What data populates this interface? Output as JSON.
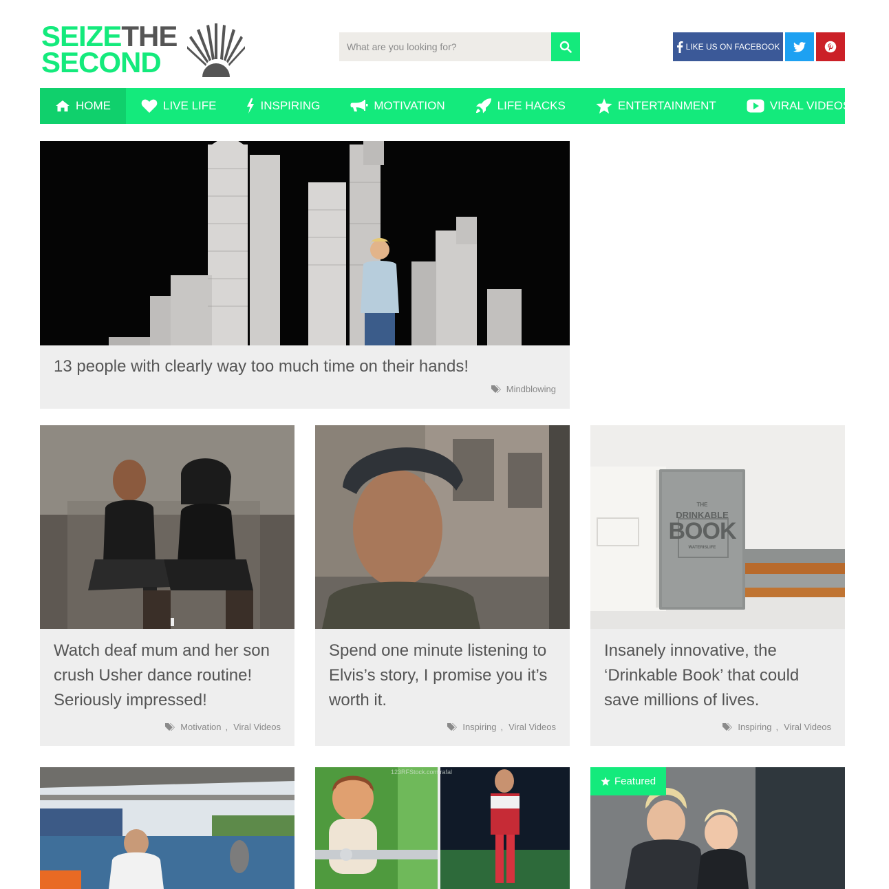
{
  "header": {
    "logo": {
      "line1_green": "SEIZE",
      "line1_dark": "THE",
      "line2_green": "SECOND"
    },
    "search": {
      "placeholder": "What are you looking for?"
    },
    "social": {
      "facebook_label": "LIKE US ON FACEBOOK"
    }
  },
  "nav": {
    "items": [
      {
        "label": "HOME",
        "icon": "home-icon"
      },
      {
        "label": "LIVE LIFE",
        "icon": "heart-icon"
      },
      {
        "label": "INSPIRING",
        "icon": "bolt-icon"
      },
      {
        "label": "MOTIVATION",
        "icon": "megaphone-icon"
      },
      {
        "label": "LIFE HACKS",
        "icon": "rocket-icon"
      },
      {
        "label": "ENTERTAINMENT",
        "icon": "star-icon"
      },
      {
        "label": "VIRAL VIDEOS",
        "icon": "play-icon"
      }
    ]
  },
  "featured": {
    "title": "13 people with clearly way too much time on their hands!",
    "tags": "Mindblowing"
  },
  "posts": [
    {
      "title": "Watch deaf mum and her son crush Usher dance routine! Seriously impressed!",
      "tag1": "Motivation",
      "tag2": "Viral Videos"
    },
    {
      "title": "Spend one minute listening to Elvis’s story, I promise you it’s worth it.",
      "tag1": "Inspiring",
      "tag2": "Viral Videos"
    },
    {
      "title": "Insanely innovative, the ‘Drinkable Book’ that could save millions of lives.",
      "tag1": "Inspiring",
      "tag2": "Viral Videos"
    }
  ],
  "bottom_cards": {
    "featured_badge": "Featured"
  },
  "image_text": {
    "book_top": "THE",
    "book_main_1": "DRINKABLE",
    "book_main_2": "BOOK",
    "book_sub": "WATERISLIFE",
    "stock_watermark": "123RFStock.com/rafal"
  },
  "colors": {
    "brand_green": "#14ea7c",
    "facebook": "#3b5998",
    "twitter": "#1da1f2",
    "pinterest": "#cb2027",
    "card_bg": "#eeeeee",
    "text_dark": "#555555"
  }
}
